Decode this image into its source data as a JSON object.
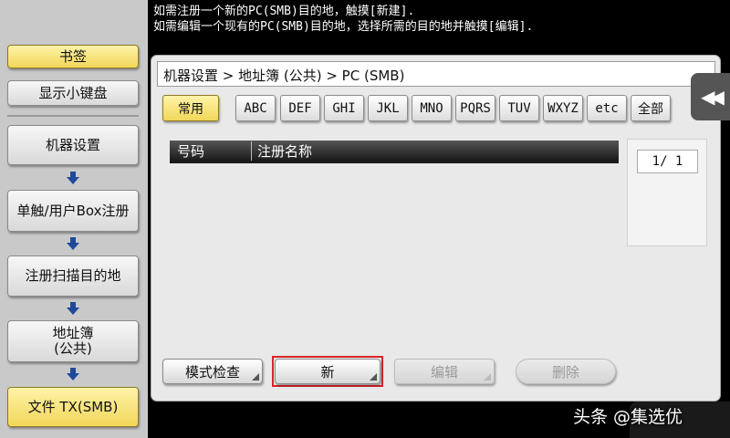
{
  "instructions": {
    "line1": "如需注册一个新的PC(SMB)目的地，触摸[新建].",
    "line2": "如需编辑一个现有的PC(SMB)目的地，选择所需的目的地并触摸[编辑]."
  },
  "sidebar": {
    "bookmark": "书签",
    "keypad": "显示小键盘",
    "items": [
      {
        "label": "机器设置"
      },
      {
        "label": "单触/用户Box注册"
      },
      {
        "label": "注册扫描目的地"
      },
      {
        "label": "地址簿\n(公共)"
      },
      {
        "label": "文件 TX(SMB)"
      }
    ]
  },
  "breadcrumb": "机器设置 > 地址簿 (公共) > PC (SMB)",
  "tabs": [
    "常用",
    "ABC",
    "DEF",
    "GHI",
    "JKL",
    "MNO",
    "PQRS",
    "TUV",
    "WXYZ",
    "etc",
    "全部"
  ],
  "active_tab": "常用",
  "table": {
    "col_number": "号码",
    "col_name": "注册名称",
    "rows": []
  },
  "pager": {
    "current": "1",
    "total": "1",
    "text": "1/  1"
  },
  "buttons": {
    "mode_check": "模式检查",
    "new": "新",
    "edit": "编辑",
    "delete": "删除"
  },
  "watermark": "头条 @集选优",
  "colors": {
    "highlight_yellow": "#f1d75a",
    "highlight_red": "#d9262b",
    "header_black": "#1b1b1b",
    "arrow_blue": "#1f4a9a"
  },
  "icons": {
    "back": "double-chevron-left-icon",
    "flow_arrow": "down-arrow-icon"
  }
}
